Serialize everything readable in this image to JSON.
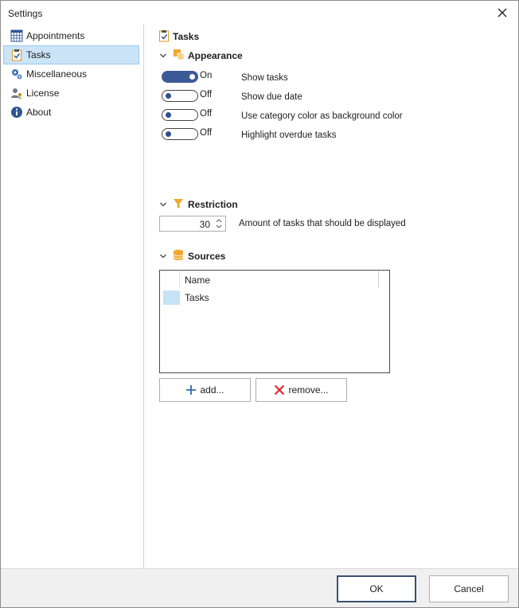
{
  "window": {
    "title": "Settings",
    "close_icon": "close-icon"
  },
  "sidebar": {
    "items": [
      {
        "label": "Appointments",
        "icon": "calendar-grid-icon",
        "selected": false
      },
      {
        "label": "Tasks",
        "icon": "clipboard-check-icon",
        "selected": true
      },
      {
        "label": "Miscellaneous",
        "icon": "gears-icon",
        "selected": false
      },
      {
        "label": "License",
        "icon": "user-key-icon",
        "selected": false
      },
      {
        "label": "About",
        "icon": "info-icon",
        "selected": false
      }
    ]
  },
  "main": {
    "header": {
      "title": "Tasks",
      "icon": "clipboard-check-icon"
    },
    "appearance": {
      "title": "Appearance",
      "toggles": [
        {
          "state": "On",
          "label": "Show tasks",
          "on": true
        },
        {
          "state": "Off",
          "label": "Show due date",
          "on": false
        },
        {
          "state": "Off",
          "label": "Use category color as background color",
          "on": false
        },
        {
          "state": "Off",
          "label": "Highlight overdue tasks",
          "on": false
        }
      ]
    },
    "restriction": {
      "title": "Restriction",
      "value": "30",
      "label": "Amount of tasks that should be displayed"
    },
    "sources": {
      "title": "Sources",
      "column_header": "Name",
      "rows": [
        {
          "name": "Tasks",
          "color": "#c6e2f5"
        }
      ],
      "add_label": "add...",
      "remove_label": "remove..."
    }
  },
  "footer": {
    "ok_label": "OK",
    "cancel_label": "Cancel"
  },
  "colors": {
    "toggle_on": "#3d5a98",
    "selection": "#cce4f7",
    "accent_orange": "#f0a830",
    "remove_red": "#d9262c",
    "add_blue": "#2e6db5"
  }
}
